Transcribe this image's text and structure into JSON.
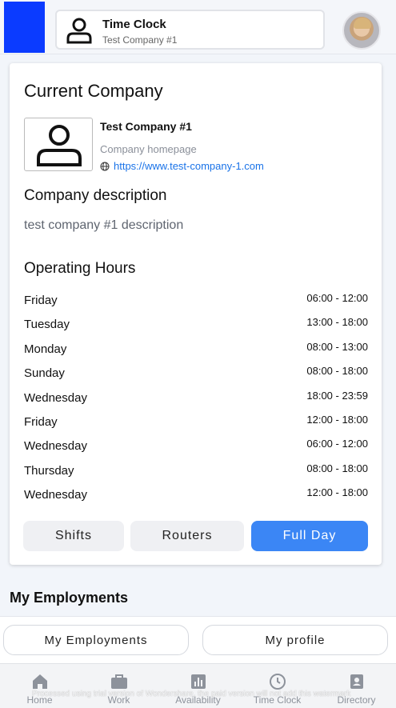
{
  "header": {
    "title": "Time Clock",
    "company": "Test Company #1"
  },
  "card": {
    "title": "Current Company",
    "company_name": "Test Company #1",
    "homepage_label": "Company homepage",
    "homepage_url": "https://www.test-company-1.com",
    "description_title": "Company description",
    "description": "test company #1 description",
    "hours_title": "Operating Hours",
    "hours": [
      {
        "day": "Friday",
        "time": "06:00 - 12:00"
      },
      {
        "day": "Tuesday",
        "time": "13:00 - 18:00"
      },
      {
        "day": "Monday",
        "time": "08:00 - 13:00"
      },
      {
        "day": "Sunday",
        "time": "08:00 - 18:00"
      },
      {
        "day": "Wednesday",
        "time": "18:00 - 23:59"
      },
      {
        "day": "Friday",
        "time": "12:00 - 18:00"
      },
      {
        "day": "Wednesday",
        "time": "06:00 - 12:00"
      },
      {
        "day": "Thursday",
        "time": "08:00 - 18:00"
      },
      {
        "day": "Wednesday",
        "time": "12:00 - 18:00"
      }
    ],
    "buttons": {
      "shifts": "Shifts",
      "routers": "Routers",
      "full_day": "Full Day"
    }
  },
  "employments": {
    "title": "My Employments",
    "pill_employments": "My Employments",
    "pill_profile": "My profile"
  },
  "tabbar": {
    "tabs": [
      {
        "label": "Home",
        "icon": "home-icon"
      },
      {
        "label": "Work",
        "icon": "briefcase-icon"
      },
      {
        "label": "Availability",
        "icon": "chart-icon"
      },
      {
        "label": "Time Clock",
        "icon": "clock-icon"
      },
      {
        "label": "Directory",
        "icon": "contacts-icon"
      }
    ]
  },
  "banner": "Processed using trial version of Wondershare, the paid version will not add this watermark",
  "colors": {
    "accent": "#3b86f5",
    "brand_block": "#0b3bff",
    "link": "#1a73e8"
  }
}
